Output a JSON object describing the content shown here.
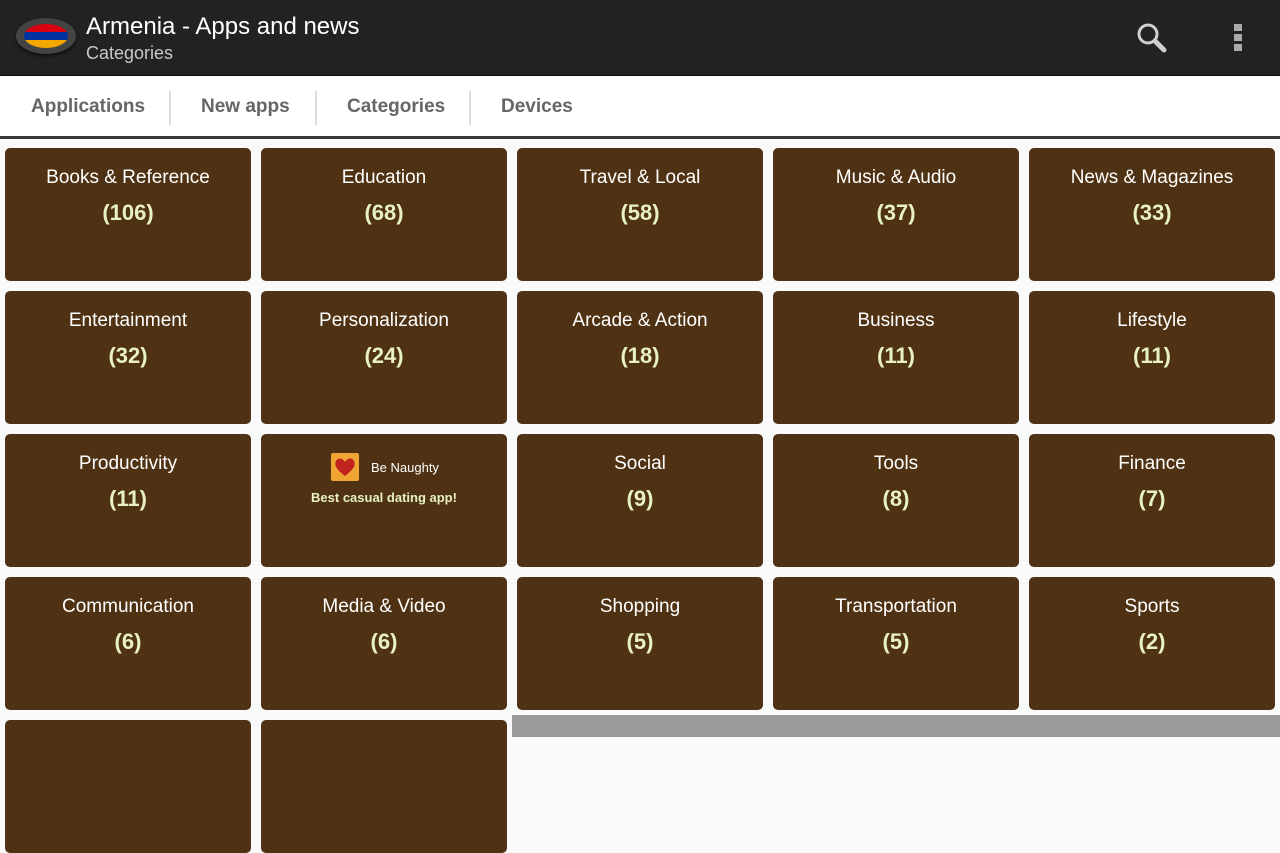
{
  "appbar": {
    "title": "Armenia - Apps and news",
    "subtitle": "Categories",
    "flag_colors": [
      "#d90012",
      "#0033a0",
      "#f2a800"
    ],
    "search_icon": "search-icon",
    "overflow_icon": "more-vert-icon"
  },
  "tabs": [
    {
      "label": "Applications"
    },
    {
      "label": "New apps"
    },
    {
      "label": "Categories"
    },
    {
      "label": "Devices"
    }
  ],
  "categories": [
    {
      "name": "Books & Reference",
      "count": "(106)"
    },
    {
      "name": "Education",
      "count": "(68)"
    },
    {
      "name": "Travel & Local",
      "count": "(58)"
    },
    {
      "name": "Music & Audio",
      "count": "(37)"
    },
    {
      "name": "News & Magazines",
      "count": "(33)"
    },
    {
      "name": "Entertainment",
      "count": "(32)"
    },
    {
      "name": "Personalization",
      "count": "(24)"
    },
    {
      "name": "Arcade & Action",
      "count": "(18)"
    },
    {
      "name": "Business",
      "count": "(11)"
    },
    {
      "name": "Lifestyle",
      "count": "(11)"
    },
    {
      "name": "Productivity",
      "count": "(11)"
    },
    {
      "name": "Social",
      "count": "(9)"
    },
    {
      "name": "Tools",
      "count": "(8)"
    },
    {
      "name": "Finance",
      "count": "(7)"
    },
    {
      "name": "Communication",
      "count": "(6)"
    },
    {
      "name": "Media & Video",
      "count": "(6)"
    },
    {
      "name": "Shopping",
      "count": "(5)"
    },
    {
      "name": "Transportation",
      "count": "(5)"
    },
    {
      "name": "Sports",
      "count": "(2)"
    }
  ],
  "ad": {
    "app_name": "Be Naughty",
    "tagline": "Best casual dating app!",
    "icon": "heart-icon"
  },
  "colors": {
    "tile_bg": "#4f3213",
    "count_text": "#e8f1c4",
    "appbar_bg": "#222222"
  }
}
